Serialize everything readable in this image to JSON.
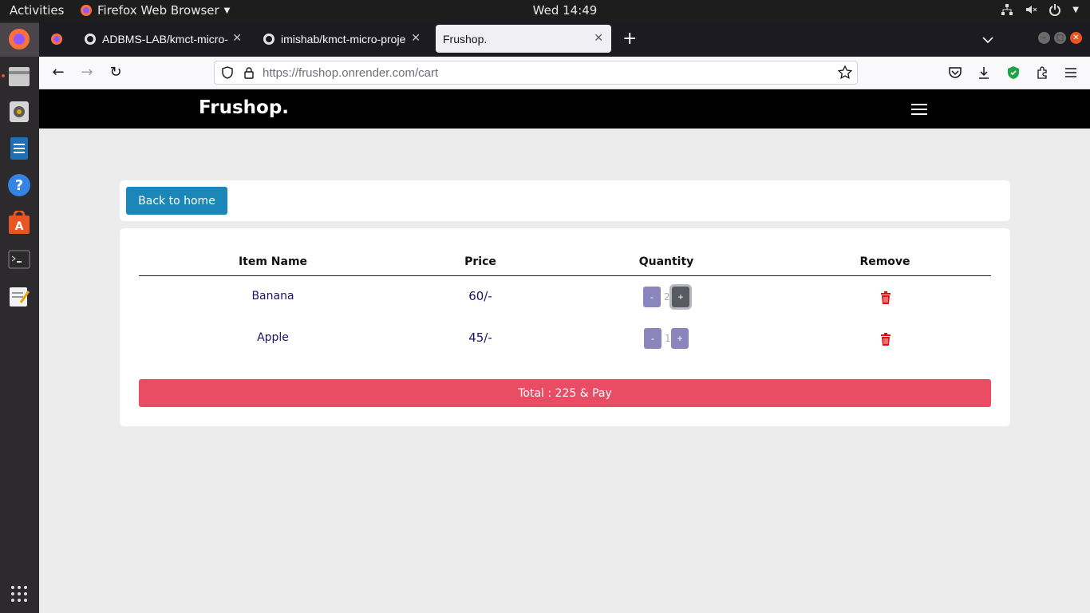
{
  "system": {
    "activities_label": "Activities",
    "app_menu_label": "Firefox Web Browser",
    "clock": "Wed 14:49"
  },
  "browser": {
    "tabs": [
      {
        "title": "ADBMS-LAB/kmct-micro-"
      },
      {
        "title": "imishab/kmct-micro-proje"
      },
      {
        "title": "Frushop."
      }
    ],
    "url_host": "https://frushop.onrender.com",
    "url_path": "/cart"
  },
  "site": {
    "brand": "Frushop.",
    "back_button_label": "Back to home"
  },
  "cart": {
    "columns": [
      "Item Name",
      "Price",
      "Quantity",
      "Remove"
    ],
    "items": [
      {
        "name": "Banana",
        "price": "60/-",
        "quantity": "2",
        "minus": "-",
        "plus": "+"
      },
      {
        "name": "Apple",
        "price": "45/-",
        "quantity": "1",
        "minus": "-",
        "plus": "+"
      }
    ],
    "pay_label": "Total : 225 & Pay"
  },
  "colors": {
    "header_bg": "#000000",
    "primary_button": "#1b87b8",
    "pay_button": "#ea4c64",
    "qty_button": "#8a86bd",
    "trash": "#e01010"
  }
}
